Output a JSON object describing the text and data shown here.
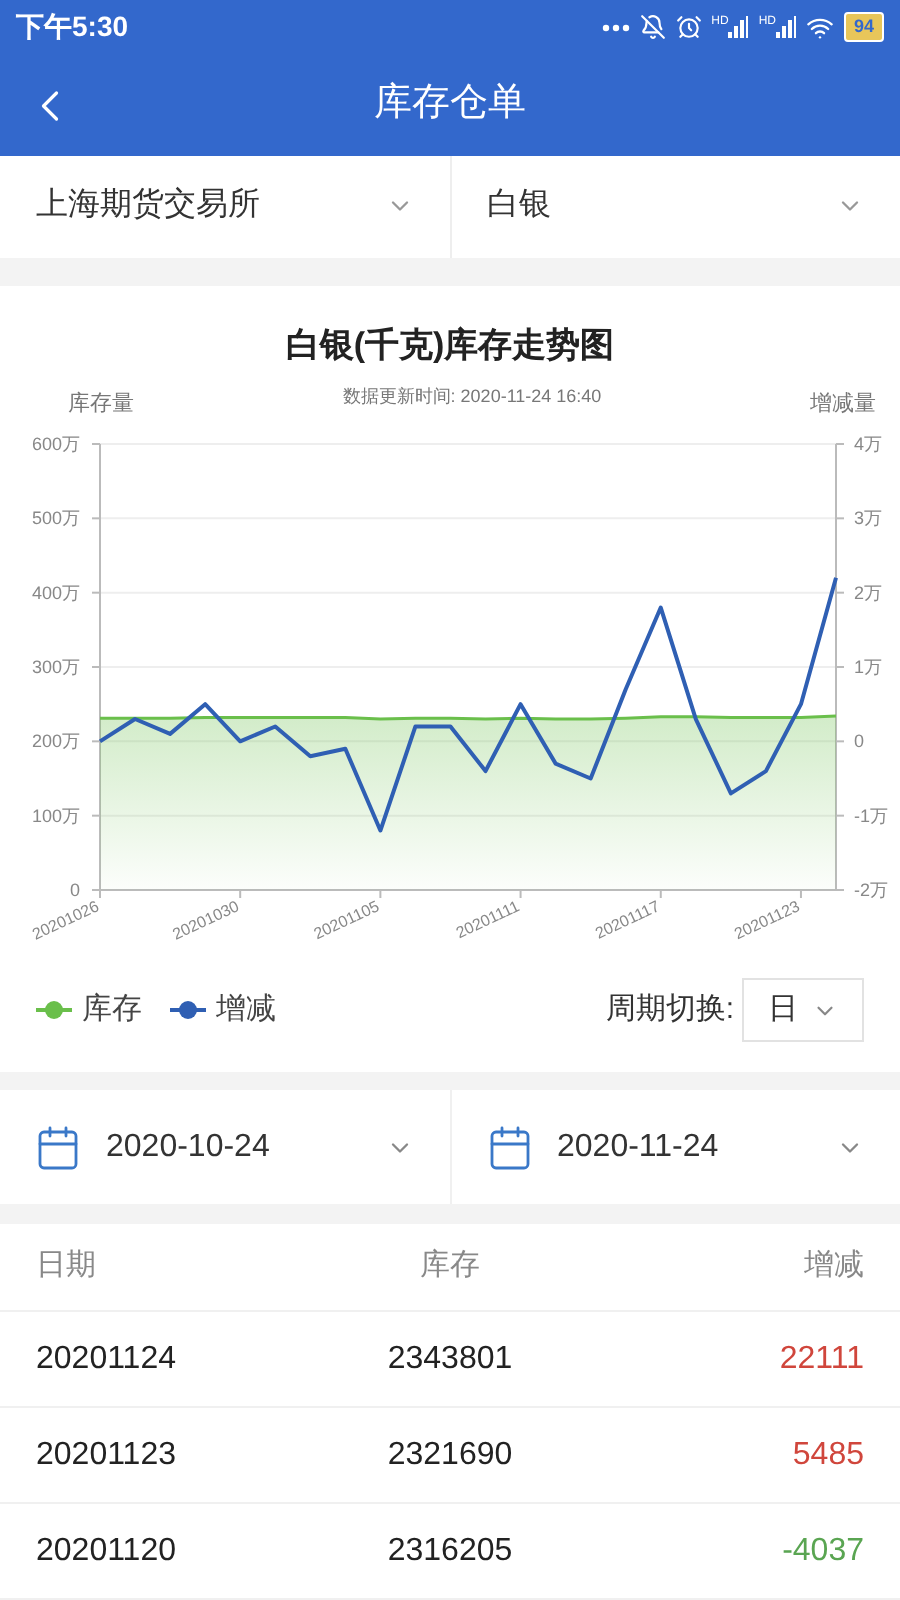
{
  "status_bar": {
    "time": "下午5:30",
    "signals": [
      {
        "label": "HD"
      },
      {
        "label": "HD"
      }
    ],
    "battery": "94"
  },
  "header": {
    "title": "库存仓单"
  },
  "filters": [
    {
      "value": "上海期货交易所"
    },
    {
      "value": "白银"
    }
  ],
  "chart": {
    "chart_data": {
      "type": "line",
      "grid": true,
      "title": "白银(千克)库存走势图",
      "subtitle": "数据更新时间: 2020-11-24 16:40",
      "ylabel": "库存量",
      "y2label": "增减量",
      "categories": [
        "20201026",
        null,
        null,
        null,
        "20201030",
        null,
        null,
        null,
        "20201105",
        null,
        null,
        null,
        "20201111",
        null,
        null,
        null,
        "20201117",
        null,
        null,
        null,
        "20201123",
        null
      ],
      "ylim": [
        0,
        600
      ],
      "yticks": [
        {
          "value": 0,
          "label": "0"
        },
        {
          "value": 100,
          "label": "100万"
        },
        {
          "value": 200,
          "label": "200万"
        },
        {
          "value": 300,
          "label": "300万"
        },
        {
          "value": 400,
          "label": "400万"
        },
        {
          "value": 500,
          "label": "500万"
        },
        {
          "value": 600,
          "label": "600万"
        }
      ],
      "y2lim": [
        -2,
        4
      ],
      "y2ticks": [
        {
          "value": -2,
          "label": "-2万"
        },
        {
          "value": -1,
          "label": "-1万"
        },
        {
          "value": 0,
          "label": "0"
        },
        {
          "value": 1,
          "label": "1万"
        },
        {
          "value": 2,
          "label": "2万"
        },
        {
          "value": 3,
          "label": "3万"
        },
        {
          "value": 4,
          "label": "4万"
        }
      ],
      "series": [
        {
          "name": "库存",
          "color": "#6abf4b",
          "values": [
            231,
            231,
            231,
            232,
            232,
            232,
            232,
            232,
            230,
            231,
            231,
            230,
            231,
            230,
            230,
            231,
            233,
            233,
            232,
            232,
            232,
            234
          ]
        },
        {
          "name": "增减",
          "color": "#2f5fb3",
          "axis": "y2",
          "values": [
            0,
            0.3,
            0.1,
            0.5,
            0,
            0.2,
            -0.2,
            -0.1,
            -1.2,
            0.2,
            0.2,
            -0.4,
            0.5,
            -0.3,
            -0.5,
            0.7,
            1.8,
            0.3,
            -0.7,
            -0.4,
            0.5,
            2.2
          ]
        }
      ]
    },
    "period": {
      "label": "周期切换:",
      "value": "日"
    }
  },
  "date_range": [
    {
      "value": "2020-10-24"
    },
    {
      "value": "2020-11-24"
    }
  ],
  "table": {
    "columns": [
      "日期",
      "库存",
      "增减"
    ],
    "rows": [
      {
        "date": "20201124",
        "stock": "2343801",
        "change": "22111",
        "color": "#d0463c"
      },
      {
        "date": "20201123",
        "stock": "2321690",
        "change": "5485",
        "color": "#d0463c"
      },
      {
        "date": "20201120",
        "stock": "2316205",
        "change": "-4037",
        "color": "#5aa552"
      }
    ]
  }
}
